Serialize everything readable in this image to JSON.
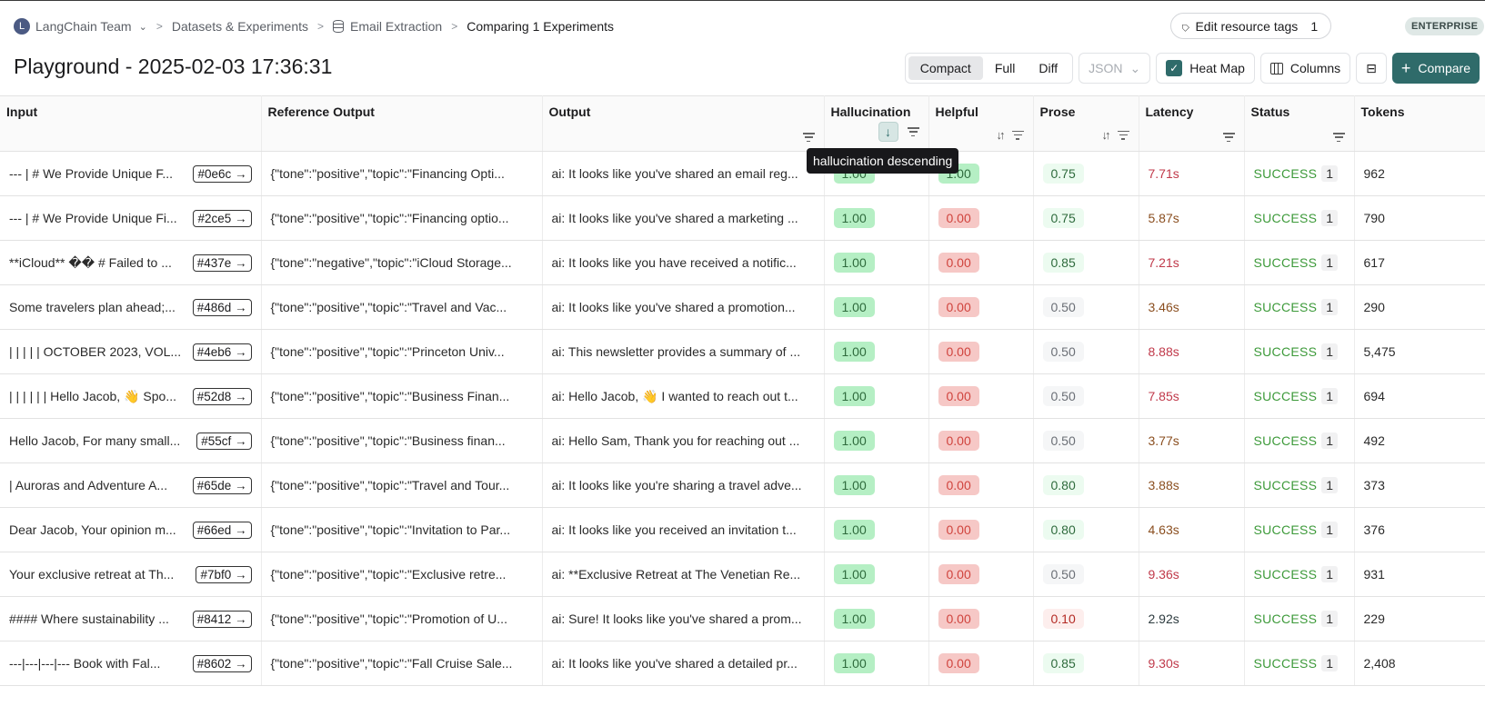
{
  "breadcrumb": {
    "avatar_letter": "L",
    "team": "LangChain Team",
    "datasets": "Datasets & Experiments",
    "dataset": "Email Extraction",
    "current": "Comparing 1 Experiments"
  },
  "header": {
    "edit_tags_label": "Edit resource tags",
    "edit_tags_count": "1",
    "plan_badge": "ENTERPRISE",
    "title": "Playground - 2025-02-03 17:36:31"
  },
  "toolbar": {
    "view_modes": [
      "Compact",
      "Full",
      "Diff"
    ],
    "active_view": "Compact",
    "format_select": "JSON",
    "heatmap_label": "Heat Map",
    "heatmap_checked": true,
    "columns_label": "Columns",
    "compare_label": "Compare",
    "accent_color": "#2f6b6a"
  },
  "table": {
    "columns": [
      "Input",
      "Reference Output",
      "Output",
      "Hallucination",
      "Helpful",
      "Prose",
      "Latency",
      "Status",
      "Tokens"
    ],
    "sort": {
      "column": "Hallucination",
      "direction": "descending"
    },
    "tooltip": "hallucination descending",
    "rows": [
      {
        "input": "--- | # We Provide Unique F...",
        "id": "#0e6c",
        "reference": "{\"tone\":\"positive\",\"topic\":\"Financing Opti...",
        "output": "ai: It looks like you've shared an email reg...",
        "hallucination": "1.00",
        "helpful": "1.00",
        "prose": "0.75",
        "latency": "7.71s",
        "status": "SUCCESS",
        "status_count": "1",
        "tokens": "962"
      },
      {
        "input": "--- | # We Provide Unique Fi...",
        "id": "#2ce5",
        "reference": "{\"tone\":\"positive\",\"topic\":\"Financing optio...",
        "output": "ai: It looks like you've shared a marketing ...",
        "hallucination": "1.00",
        "helpful": "0.00",
        "prose": "0.75",
        "latency": "5.87s",
        "status": "SUCCESS",
        "status_count": "1",
        "tokens": "790"
      },
      {
        "input": "**iCloud** �� # Failed to ...",
        "id": "#437e",
        "reference": "{\"tone\":\"negative\",\"topic\":\"iCloud Storage...",
        "output": "ai: It looks like you have received a notific...",
        "hallucination": "1.00",
        "helpful": "0.00",
        "prose": "0.85",
        "latency": "7.21s",
        "status": "SUCCESS",
        "status_count": "1",
        "tokens": "617"
      },
      {
        "input": "Some travelers plan ahead;...",
        "id": "#486d",
        "reference": "{\"tone\":\"positive\",\"topic\":\"Travel and Vac...",
        "output": "ai: It looks like you've shared a promotion...",
        "hallucination": "1.00",
        "helpful": "0.00",
        "prose": "0.50",
        "latency": "3.46s",
        "status": "SUCCESS",
        "status_count": "1",
        "tokens": "290"
      },
      {
        "input": "| | | | | OCTOBER 2023, VOL...",
        "id": "#4eb6",
        "reference": "{\"tone\":\"positive\",\"topic\":\"Princeton Univ...",
        "output": "ai: This newsletter provides a summary of ...",
        "hallucination": "1.00",
        "helpful": "0.00",
        "prose": "0.50",
        "latency": "8.88s",
        "status": "SUCCESS",
        "status_count": "1",
        "tokens": "5,475"
      },
      {
        "input": "| | | | | | Hello Jacob, 👋 Spo...",
        "id": "#52d8",
        "reference": "{\"tone\":\"positive\",\"topic\":\"Business Finan...",
        "output": "ai: Hello Jacob, 👋 I wanted to reach out t...",
        "hallucination": "1.00",
        "helpful": "0.00",
        "prose": "0.50",
        "latency": "7.85s",
        "status": "SUCCESS",
        "status_count": "1",
        "tokens": "694"
      },
      {
        "input": "Hello Jacob, For many small...",
        "id": "#55cf",
        "reference": "{\"tone\":\"positive\",\"topic\":\"Business finan...",
        "output": "ai: Hello Sam, Thank you for reaching out ...",
        "hallucination": "1.00",
        "helpful": "0.00",
        "prose": "0.50",
        "latency": "3.77s",
        "status": "SUCCESS",
        "status_count": "1",
        "tokens": "492"
      },
      {
        "input": "| Auroras and Adventure A...",
        "id": "#65de",
        "reference": "{\"tone\":\"positive\",\"topic\":\"Travel and Tour...",
        "output": "ai: It looks like you're sharing a travel adve...",
        "hallucination": "1.00",
        "helpful": "0.00",
        "prose": "0.80",
        "latency": "3.88s",
        "status": "SUCCESS",
        "status_count": "1",
        "tokens": "373"
      },
      {
        "input": "Dear Jacob, Your opinion m...",
        "id": "#66ed",
        "reference": "{\"tone\":\"positive\",\"topic\":\"Invitation to Par...",
        "output": "ai: It looks like you received an invitation t...",
        "hallucination": "1.00",
        "helpful": "0.00",
        "prose": "0.80",
        "latency": "4.63s",
        "status": "SUCCESS",
        "status_count": "1",
        "tokens": "376"
      },
      {
        "input": "Your exclusive retreat at Th...",
        "id": "#7bf0",
        "reference": "{\"tone\":\"positive\",\"topic\":\"Exclusive retre...",
        "output": "ai: **Exclusive Retreat at The Venetian Re...",
        "hallucination": "1.00",
        "helpful": "0.00",
        "prose": "0.50",
        "latency": "9.36s",
        "status": "SUCCESS",
        "status_count": "1",
        "tokens": "931"
      },
      {
        "input": "#### Where sustainability ...",
        "id": "#8412",
        "reference": "{\"tone\":\"positive\",\"topic\":\"Promotion of U...",
        "output": "ai: Sure! It looks like you've shared a prom...",
        "hallucination": "1.00",
        "helpful": "0.00",
        "prose": "0.10",
        "latency": "2.92s",
        "status": "SUCCESS",
        "status_count": "1",
        "tokens": "229"
      },
      {
        "input": "---|---|---|--- Book with Fal...",
        "id": "#8602",
        "reference": "{\"tone\":\"positive\",\"topic\":\"Fall Cruise Sale...",
        "output": "ai: It looks like you've shared a detailed pr...",
        "hallucination": "1.00",
        "helpful": "0.00",
        "prose": "0.85",
        "latency": "9.30s",
        "status": "SUCCESS",
        "status_count": "1",
        "tokens": "2,408"
      }
    ]
  }
}
